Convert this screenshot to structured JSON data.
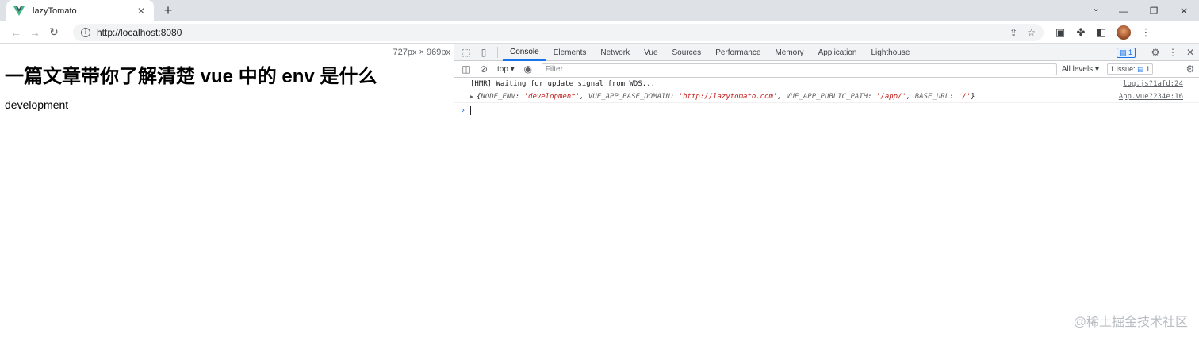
{
  "browser": {
    "tab_title": "lazyTomato",
    "url": "http://localhost:8080"
  },
  "page": {
    "dimensions": "727px × 969px",
    "heading": "一篇文章带你了解清楚 vue 中的 env 是什么",
    "env_value": "development"
  },
  "devtools": {
    "tabs": [
      "Console",
      "Elements",
      "Network",
      "Vue",
      "Sources",
      "Performance",
      "Memory",
      "Application",
      "Lighthouse"
    ],
    "active_tab": "Console",
    "message_badge": "1",
    "context": "top",
    "filter_placeholder": "Filter",
    "levels": "All levels",
    "issues_label": "1 Issue:",
    "issues_count": "1",
    "messages": {
      "m1": {
        "text": "[HMR] Waiting for update signal from WDS...",
        "source": "log.js?1afd:24"
      },
      "m2": {
        "source": "App.vue?234e:16",
        "open": "{",
        "k1": "NODE_ENV",
        "v1": "'development'",
        "k2": "VUE_APP_BASE_DOMAIN",
        "v2": "'http://lazytomato.com'",
        "k3": "VUE_APP_PUBLIC_PATH",
        "v3": "'/app/'",
        "k4": "BASE_URL",
        "v4": "'/'",
        "close": "}"
      }
    }
  },
  "watermark": "@稀土掘金技术社区",
  "colors": {
    "accent": "#1a73e8",
    "string": "#c41a16",
    "vue_green": "#41b883"
  }
}
